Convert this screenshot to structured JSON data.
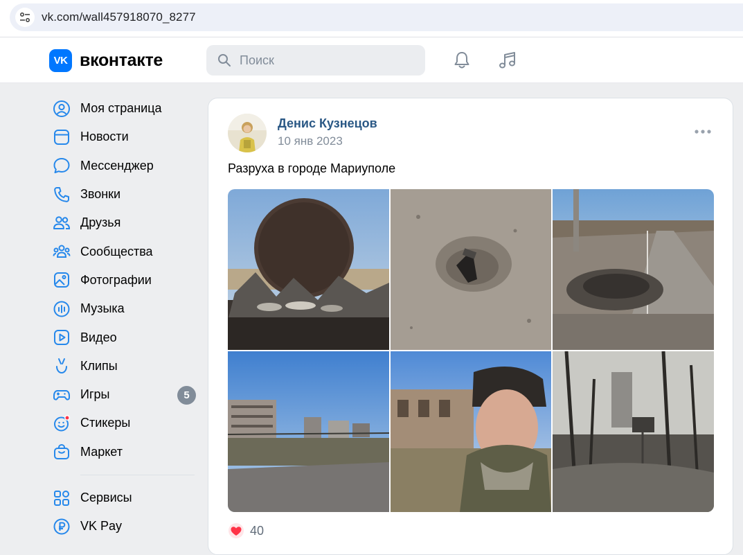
{
  "browser": {
    "url": "vk.com/wall457918070_8277"
  },
  "header": {
    "logo_mark": "VK",
    "logo_text": "вконтакте",
    "search_placeholder": "Поиск",
    "icons": [
      "bell-icon",
      "music-icon"
    ]
  },
  "sidebar": {
    "items": [
      {
        "label": "Моя страница",
        "icon": "user-circle-icon"
      },
      {
        "label": "Новости",
        "icon": "news-icon"
      },
      {
        "label": "Мессенджер",
        "icon": "chat-bubble-icon"
      },
      {
        "label": "Звонки",
        "icon": "phone-icon"
      },
      {
        "label": "Друзья",
        "icon": "friends-icon"
      },
      {
        "label": "Сообщества",
        "icon": "communities-icon"
      },
      {
        "label": "Фотографии",
        "icon": "photo-icon"
      },
      {
        "label": "Музыка",
        "icon": "music-bars-icon"
      },
      {
        "label": "Видео",
        "icon": "video-icon"
      },
      {
        "label": "Клипы",
        "icon": "clips-icon"
      },
      {
        "label": "Игры",
        "icon": "gamepad-icon",
        "badge": "5"
      },
      {
        "label": "Стикеры",
        "icon": "sticker-icon"
      },
      {
        "label": "Маркет",
        "icon": "market-bag-icon"
      }
    ],
    "extra_items": [
      {
        "label": "Сервисы",
        "icon": "services-grid-icon"
      },
      {
        "label": "VK Pay",
        "icon": "vkpay-icon"
      }
    ]
  },
  "post": {
    "author": "Денис Кузнецов",
    "date": "10 янв 2023",
    "text": "Разруха в городе Мариуполе",
    "likes": "40",
    "photo_count": 6
  },
  "colors": {
    "accent": "#0077ff",
    "link": "#2a5885",
    "secondary_text": "#818c99",
    "like_red": "#ff3347",
    "page_bg": "#edeef0"
  }
}
